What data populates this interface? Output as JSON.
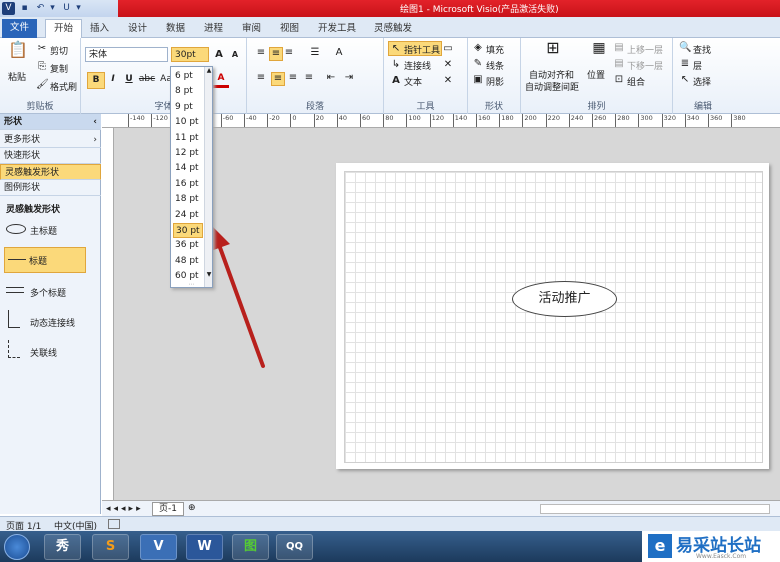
{
  "window": {
    "title": "绘图1 - Microsoft Visio(产品激活失败)"
  },
  "qat": [
    "V",
    "▾",
    "↶",
    "▾",
    "U",
    "▾"
  ],
  "tabs": [
    "文件",
    "开始",
    "插入",
    "设计",
    "数据",
    "进程",
    "审阅",
    "视图",
    "开发工具",
    "灵感触发"
  ],
  "ribbon": {
    "clipboard": {
      "paste": "粘贴",
      "cut": "剪切",
      "copy": "复制",
      "painter": "格式刷",
      "label": "剪贴板"
    },
    "font": {
      "name": "宋体",
      "size": "30pt",
      "grow": "A",
      "shrink": "A",
      "bold": "B",
      "italic": "I",
      "underline": "U",
      "strike": "abc",
      "case": "Aa",
      "color": "A",
      "label": "字体"
    },
    "paragraph": {
      "label": "段落"
    },
    "tools": {
      "pointer": "指针工具",
      "connector": "连接线",
      "text": "文本",
      "label": "工具"
    },
    "shape": {
      "fill": "填充",
      "line": "线条",
      "shadow": "阴影",
      "label": "形状"
    },
    "arrange": {
      "align": "自动对齐和",
      "spacing": "自动调整间距",
      "position": "位置",
      "front": "上移一层",
      "back": "下移一层",
      "group": "组合",
      "label": "排列"
    },
    "edit": {
      "find": "查找",
      "layer": "层",
      "select": "选择",
      "label": "编辑"
    }
  },
  "pane": {
    "title": "形状",
    "items": [
      "更多形状",
      "快速形状",
      "灵感触发形状",
      "图例形状"
    ],
    "stencil_title": "灵感触发形状",
    "stencil": [
      "主标题",
      "标题",
      "多个标题",
      "动态连接线",
      "关联线"
    ]
  },
  "font_sizes": [
    "6 pt",
    "8 pt",
    "9 pt",
    "10 pt",
    "11 pt",
    "12 pt",
    "14 pt",
    "16 pt",
    "18 pt",
    "24 pt",
    "30 pt",
    "36 pt",
    "48 pt",
    "60 pt"
  ],
  "selected_size": "30 pt",
  "ruler_labels": [
    "-140",
    "-120",
    "-100",
    "-80",
    "-60",
    "-40",
    "-20",
    "0",
    "20",
    "40",
    "60",
    "80",
    "100",
    "120",
    "140",
    "160",
    "180",
    "200",
    "220",
    "240",
    "260",
    "280",
    "300",
    "320",
    "340",
    "360",
    "380"
  ],
  "canvas": {
    "shape_text": "活动推广"
  },
  "sheet": {
    "tab": "页-1"
  },
  "status": {
    "page": "页面 1/1",
    "lang": "中文(中国)"
  },
  "taskbar": [
    "秀",
    "S",
    "V",
    "W",
    "图",
    "QQ"
  ],
  "watermark": {
    "text": "易采站长站",
    "url": "Www.Easck.Com"
  },
  "colors": {
    "title_red": "#d8141c",
    "file_tab": "#2a65b9",
    "highlight": "#fbd97a",
    "arrow": "#b8201c"
  }
}
